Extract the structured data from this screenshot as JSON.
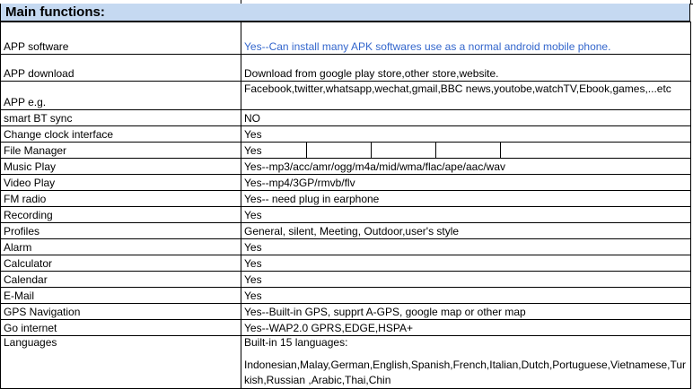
{
  "section_title": "Main functions:",
  "rows": [
    {
      "label": "APP software",
      "value": "Yes--Can install many APK softwares use as a normal android mobile phone.",
      "h": 36
    },
    {
      "label": "APP download",
      "value": "Download from google play store,other store,website.",
      "h": 30
    },
    {
      "label": "APP e.g.",
      "value": "Facebook,twitter,whatsapp,wechat,gmail,BBC news,youtobe,watchTV,Ebook,games,...etc",
      "h": 32
    },
    {
      "label": "smart BT sync",
      "value": "NO",
      "h": 18
    },
    {
      "label": "Change clock interface",
      "value": "Yes",
      "h": 18
    },
    {
      "label": "File Manager",
      "value": "Yes",
      "h": 18
    },
    {
      "label": "Music Play",
      "value": "Yes--mp3/acc/amr/ogg/m4a/mid/wma/flac/ape/aac/wav",
      "h": 18
    },
    {
      "label": "Video Play",
      "value": "Yes--mp4/3GP/rmvb/flv",
      "h": 18
    },
    {
      "label": "FM radio",
      "value": "Yes-- need plug in earphone",
      "h": 18
    },
    {
      "label": "Recording",
      "value": "Yes",
      "h": 18
    },
    {
      "label": "Profiles",
      "value": "General, silent, Meeting, Outdoor,user's style",
      "h": 18
    },
    {
      "label": "Alarm",
      "value": "Yes",
      "h": 18
    },
    {
      "label": "Calculator",
      "value": "Yes",
      "h": 18
    },
    {
      "label": "Calendar",
      "value": "Yes",
      "h": 18
    },
    {
      "label": "E-Mail",
      "value": "Yes",
      "h": 18
    },
    {
      "label": "GPS Navigation",
      "value": "Yes--Built-in GPS, supprt A-GPS, google map or other map",
      "h": 18
    },
    {
      "label": "Go internet",
      "value": "Yes--WAP2.0 GPRS,EDGE,HSPA+",
      "h": 18
    },
    {
      "label": "Languages",
      "value": "Built-in 15 languages:",
      "value2": "Indonesian,Malay,German,English,Spanish,French,Italian,Dutch,Portuguese,Vietnamese,Turkish,Russian ,Arabic,Thai,Chin",
      "h": 58
    }
  ],
  "colors": {
    "header_bg": "#c5d9f1",
    "blue_text": "#3366cc",
    "grid": "#000000"
  }
}
